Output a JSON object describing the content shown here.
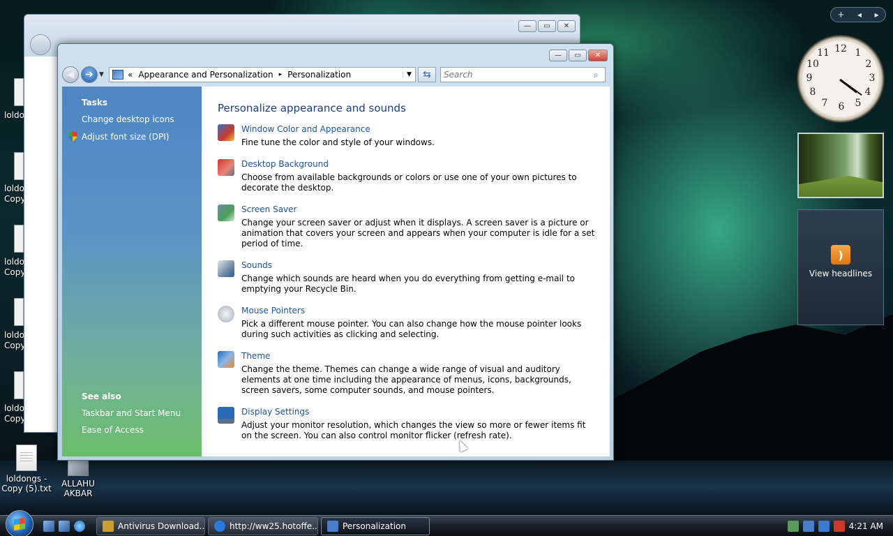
{
  "desktop": {
    "icons_left_labels": [
      "loldo",
      "loldo",
      "Copy",
      "loldo",
      "Copy",
      "loldo",
      "Copy",
      "loldo",
      "Copy"
    ],
    "icon_bottom_1": {
      "line1": "loldongs -",
      "line2": "Copy (5).txt"
    },
    "icon_bottom_2": {
      "line1": "ALLAHU",
      "line2": "AKBAR"
    }
  },
  "window": {
    "address": {
      "chevron": "«",
      "crumb1": "Appearance and Personalization",
      "separator": "▸",
      "crumb2": "Personalization"
    },
    "search_placeholder": "Search",
    "caption": {
      "minimize": "—",
      "maximize": "▭",
      "close": "✕"
    },
    "left_pane": {
      "tasks_header": "Tasks",
      "tasks": [
        "Change desktop icons",
        "Adjust font size (DPI)"
      ],
      "see_also_header": "See also",
      "see_also": [
        "Taskbar and Start Menu",
        "Ease of Access"
      ]
    },
    "main_title": "Personalize appearance and sounds",
    "items": [
      {
        "title": "Window Color and Appearance",
        "desc": "Fine tune the color and style of your windows.",
        "icon": "window-color-icon",
        "color": "#3d6fbf"
      },
      {
        "title": "Desktop Background",
        "desc": "Choose from available backgrounds or colors or use one of your own pictures to decorate the desktop.",
        "icon": "desktop-background-icon",
        "color": "#c9392c"
      },
      {
        "title": "Screen Saver",
        "desc": "Change your screen saver or adjust when it displays. A screen saver is a picture or animation that covers your screen and appears when your computer is idle for a set period of time.",
        "icon": "screen-saver-icon",
        "color": "#4aa05a"
      },
      {
        "title": "Sounds",
        "desc": "Change which sounds are heard when you do everything from getting e-mail to emptying your Recycle Bin.",
        "icon": "sounds-icon",
        "color": "#6f8aa3"
      },
      {
        "title": "Mouse Pointers",
        "desc": "Pick a different mouse pointer. You can also change how the mouse pointer looks during such activities as clicking and selecting.",
        "icon": "mouse-pointer-icon",
        "color": "#b9c2cc"
      },
      {
        "title": "Theme",
        "desc": "Change the theme. Themes can change a wide range of visual and auditory elements at one time including the appearance of menus, icons, backgrounds, screen savers, some computer sounds, and mouse pointers.",
        "icon": "theme-icon",
        "color": "#e4882a"
      },
      {
        "title": "Display Settings",
        "desc": "Adjust your monitor resolution, which changes the view so more or fewer items fit on the screen. You can also control monitor flicker (refresh rate).",
        "icon": "display-settings-icon",
        "color": "#2a6bb8"
      }
    ]
  },
  "gadgets": {
    "controls": {
      "add": "+",
      "prev": "◂",
      "next": "▸"
    },
    "clock_numbers": [
      "12",
      "1",
      "2",
      "3",
      "4",
      "5",
      "6",
      "7",
      "8",
      "9",
      "10",
      "11"
    ],
    "feed_label": "View headlines",
    "feed_icon": "rss-icon"
  },
  "taskbar": {
    "buttons": [
      {
        "label": "Antivirus Download...",
        "icon": "antivirus-icon",
        "color": "#c9a030"
      },
      {
        "label": "http://ww25.hotoffe...",
        "icon": "ie-icon",
        "color": "#2a7be0"
      },
      {
        "label": "Personalization",
        "icon": "personalization-icon",
        "color": "#4a7cc9"
      }
    ],
    "time": "4:21 AM"
  }
}
